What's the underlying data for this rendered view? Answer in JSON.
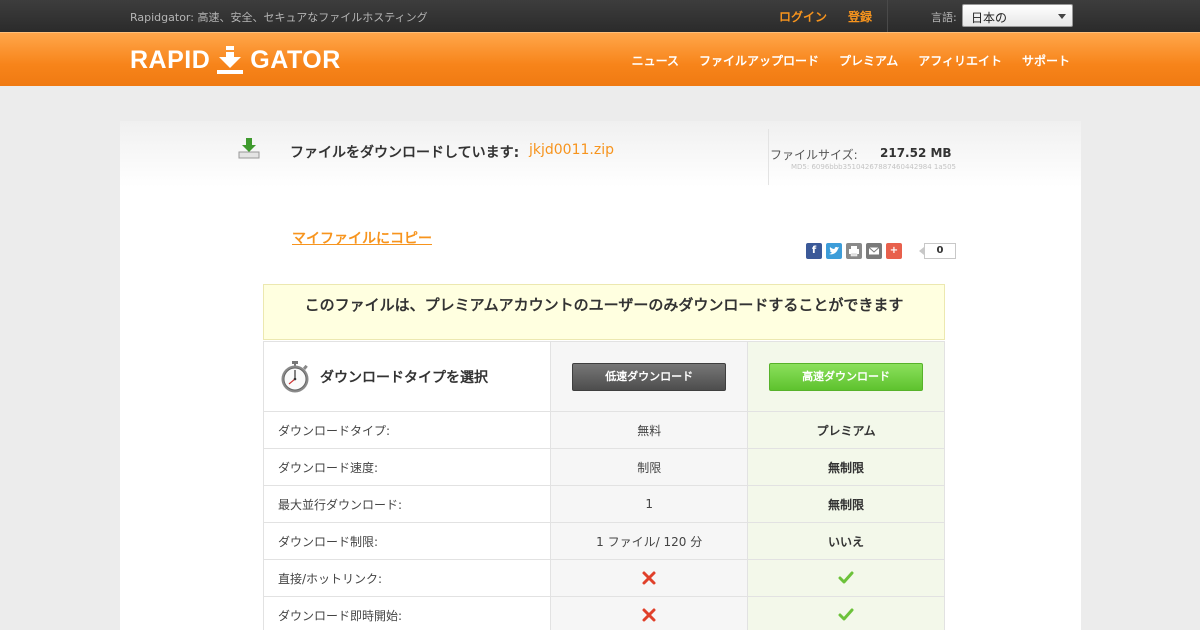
{
  "topbar": {
    "tagline": "Rapidgator: 高速、安全、セキュアなファイルホスティング",
    "login": "ログイン",
    "register": "登録",
    "language_label": "言語:",
    "language_selected": "日本の"
  },
  "header": {
    "logo_left": "RAPID",
    "logo_right": "GATOR",
    "nav": [
      "ニュース",
      "ファイルアップロード",
      "プレミアム",
      "アフィリエイト",
      "サポート"
    ]
  },
  "file": {
    "downloading_label": "ファイルをダウンロードしています:",
    "filename": "jkjd0011.zip",
    "size_label": "ファイルサイズ:",
    "size_value": "217.52 MB",
    "md5": "MD5: 6096bbb35104267887460442984 1a505"
  },
  "copy_link": "マイファイルにコピー",
  "share": {
    "count": "0",
    "colors": {
      "facebook": "#3b5998",
      "twitter": "#3d9dd9",
      "print": "#8a8a8a",
      "email": "#7a7a7a",
      "more": "#e8604c"
    }
  },
  "premium_note": "このファイルは、プレミアムアカウントのユーザーのみダウンロードすることができます",
  "table": {
    "title": "ダウンロードタイプを選択",
    "slow_button": "低速ダウンロード",
    "fast_button": "高速ダウンロード",
    "rows": [
      {
        "label": "ダウンロードタイプ:",
        "slow": "無料",
        "fast": "プレミアム"
      },
      {
        "label": "ダウンロード速度:",
        "slow": "制限",
        "fast": "無制限"
      },
      {
        "label": "最大並行ダウンロード:",
        "slow": "1",
        "fast": "無制限"
      },
      {
        "label": "ダウンロード制限:",
        "slow": "1 ファイル/ 120 分",
        "fast": "いいえ"
      },
      {
        "label": "直接/ホットリンク:",
        "slow": "cross-icon",
        "fast": "check-icon"
      },
      {
        "label": "ダウンロード即時開始:",
        "slow": "cross-icon",
        "fast": "check-icon"
      }
    ]
  },
  "colors": {
    "accent": "#f7941d",
    "fast_green": "#5ec22e"
  }
}
